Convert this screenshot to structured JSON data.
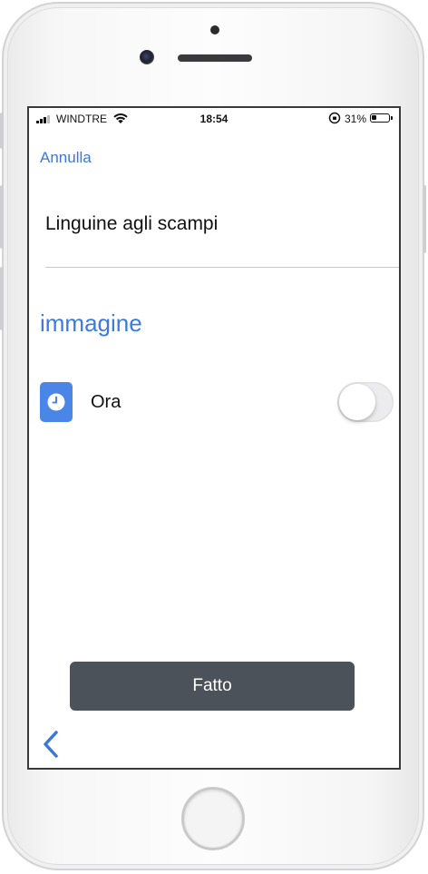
{
  "status_bar": {
    "carrier": "WINDTRE",
    "time": "18:54",
    "battery_percent": "31%",
    "battery_level": 0.31
  },
  "header": {
    "cancel_label": "Annulla"
  },
  "form": {
    "title_value": "Linguine agli scampi"
  },
  "section": {
    "header": "immagine",
    "rows": [
      {
        "label": "Ora",
        "icon": "clock-icon",
        "toggle_on": false
      }
    ]
  },
  "footer": {
    "done_label": "Fatto",
    "back_icon": "chevron-left-icon"
  },
  "colors": {
    "accent": "#3b78d8",
    "done_button_bg": "#4c525a",
    "clock_tile": "#4a86e8"
  }
}
